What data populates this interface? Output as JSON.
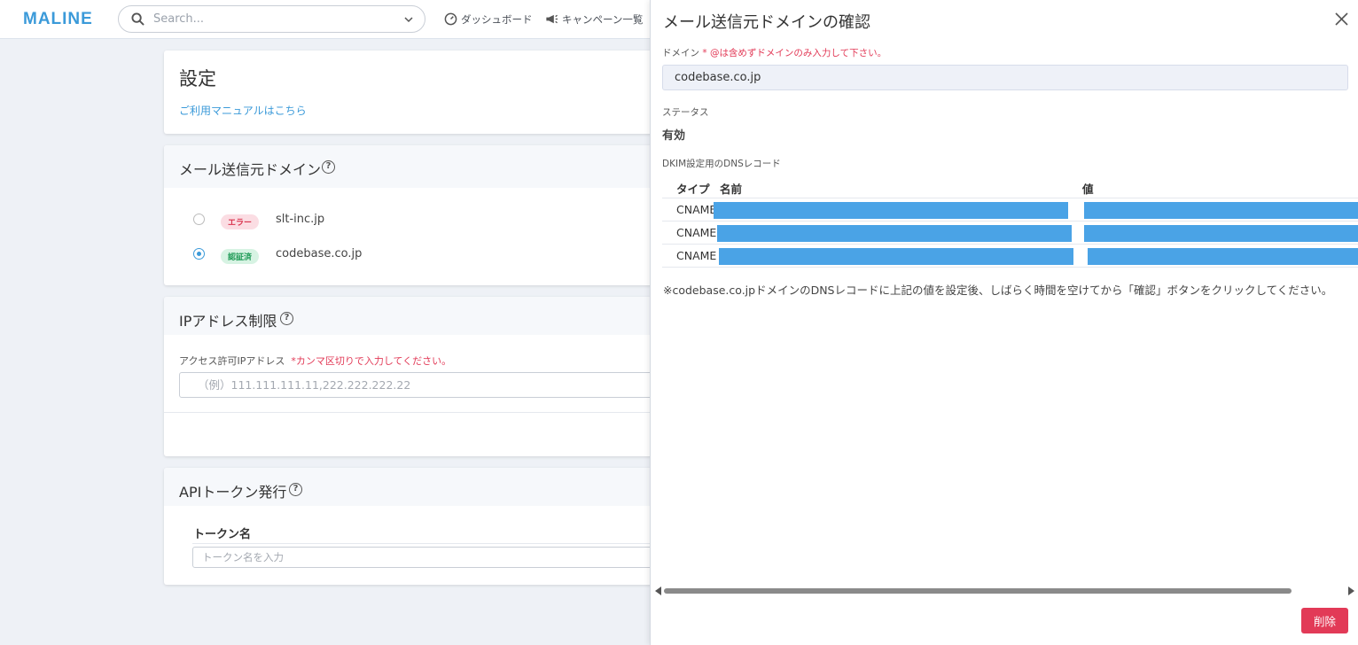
{
  "app": {
    "logo": "MALINE"
  },
  "topbar": {
    "search_placeholder": "Search...",
    "nav": [
      {
        "label": "ダッシュボード",
        "icon": "gauge-icon"
      },
      {
        "label": "キャンペーン一覧",
        "icon": "megaphone-icon"
      }
    ]
  },
  "settings": {
    "title": "設定",
    "manual_link": "ご利用マニュアルはこちら"
  },
  "sender_domain": {
    "title": "メール送信元ドメイン",
    "items": [
      {
        "badge": "エラー",
        "domain": "slt-inc.jp",
        "selected": false
      },
      {
        "badge": "認証済",
        "domain": "codebase.co.jp",
        "selected": true
      }
    ]
  },
  "ip_restriction": {
    "title": "IPアドレス制限",
    "label": "アクセス許可IPアドレス",
    "required_note": "*カンマ区切りで入力してください。",
    "placeholder": "（例）111.111.111.11,222.222.222.22"
  },
  "api_token": {
    "title": "APIトークン発行",
    "column": "トークン名",
    "placeholder": "トークン名を入力"
  },
  "panel": {
    "title": "メール送信元ドメインの確認",
    "domain_label": "ドメイン",
    "domain_required": "*",
    "domain_hint": "@は含めずドメインのみ入力して下さい。",
    "domain_value": "codebase.co.jp",
    "status_label": "ステータス",
    "status_value": "有効",
    "dkim_label": "DKIM設定用のDNSレコード",
    "dns_headers": {
      "type": "タイプ",
      "name": "名前",
      "value": "値"
    },
    "dns_records": [
      {
        "type": "CNAME"
      },
      {
        "type": "CNAME"
      },
      {
        "type": "CNAME"
      }
    ],
    "note": "※codebase.co.jpドメインのDNSレコードに上記の値を設定後、しばらく時間を空けてから「確認」ボタンをクリックしてください。",
    "delete_label": "削除"
  },
  "colors": {
    "accent": "#3b9ad9",
    "danger": "#e23a57",
    "redaction": "#4aa3e6"
  }
}
